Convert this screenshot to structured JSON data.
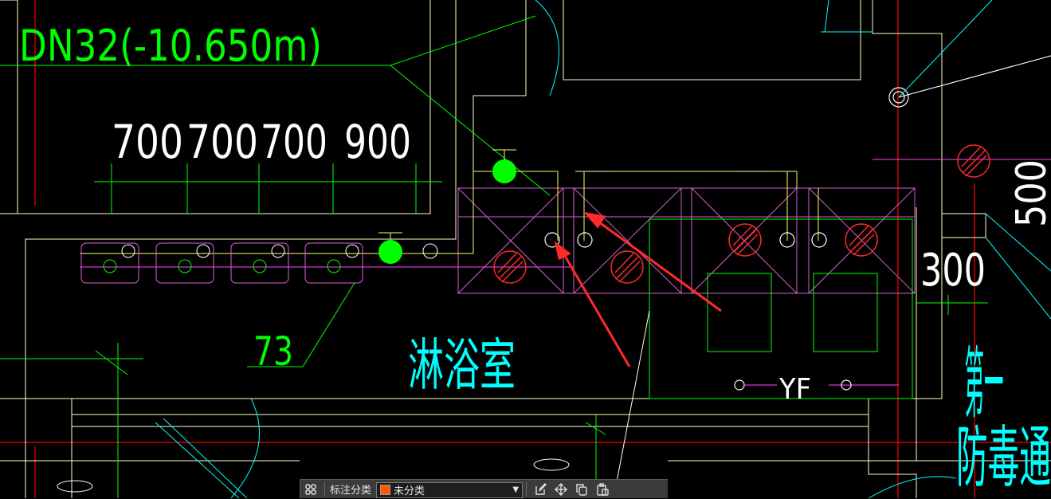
{
  "drawing": {
    "pipe_label": "DN32(-10.650m)",
    "dim_values": [
      "700",
      "700",
      "700",
      "900"
    ],
    "dim_right_top": "500",
    "dim_right_mid": "300",
    "leader_number": "73",
    "room_shower": "淋浴室",
    "label_yf": "YF",
    "room_right_line1": "第一",
    "room_right_line2": "防毒通"
  },
  "toolbar": {
    "label": "标注分类",
    "category_value": "未分类",
    "category_color": "#ff5a00",
    "icons": [
      "grid-icon",
      "edit-icon",
      "move-icon",
      "copy-icon",
      "paste-icon"
    ]
  },
  "colors": {
    "background": "#000000",
    "wall": "#ffffc8",
    "pipe_green": "#00ff00",
    "pipe_magenta": "#ff00ff",
    "axis_red": "#ff0000",
    "cyan": "#00ffff",
    "arrow": "#ff2a2a"
  }
}
